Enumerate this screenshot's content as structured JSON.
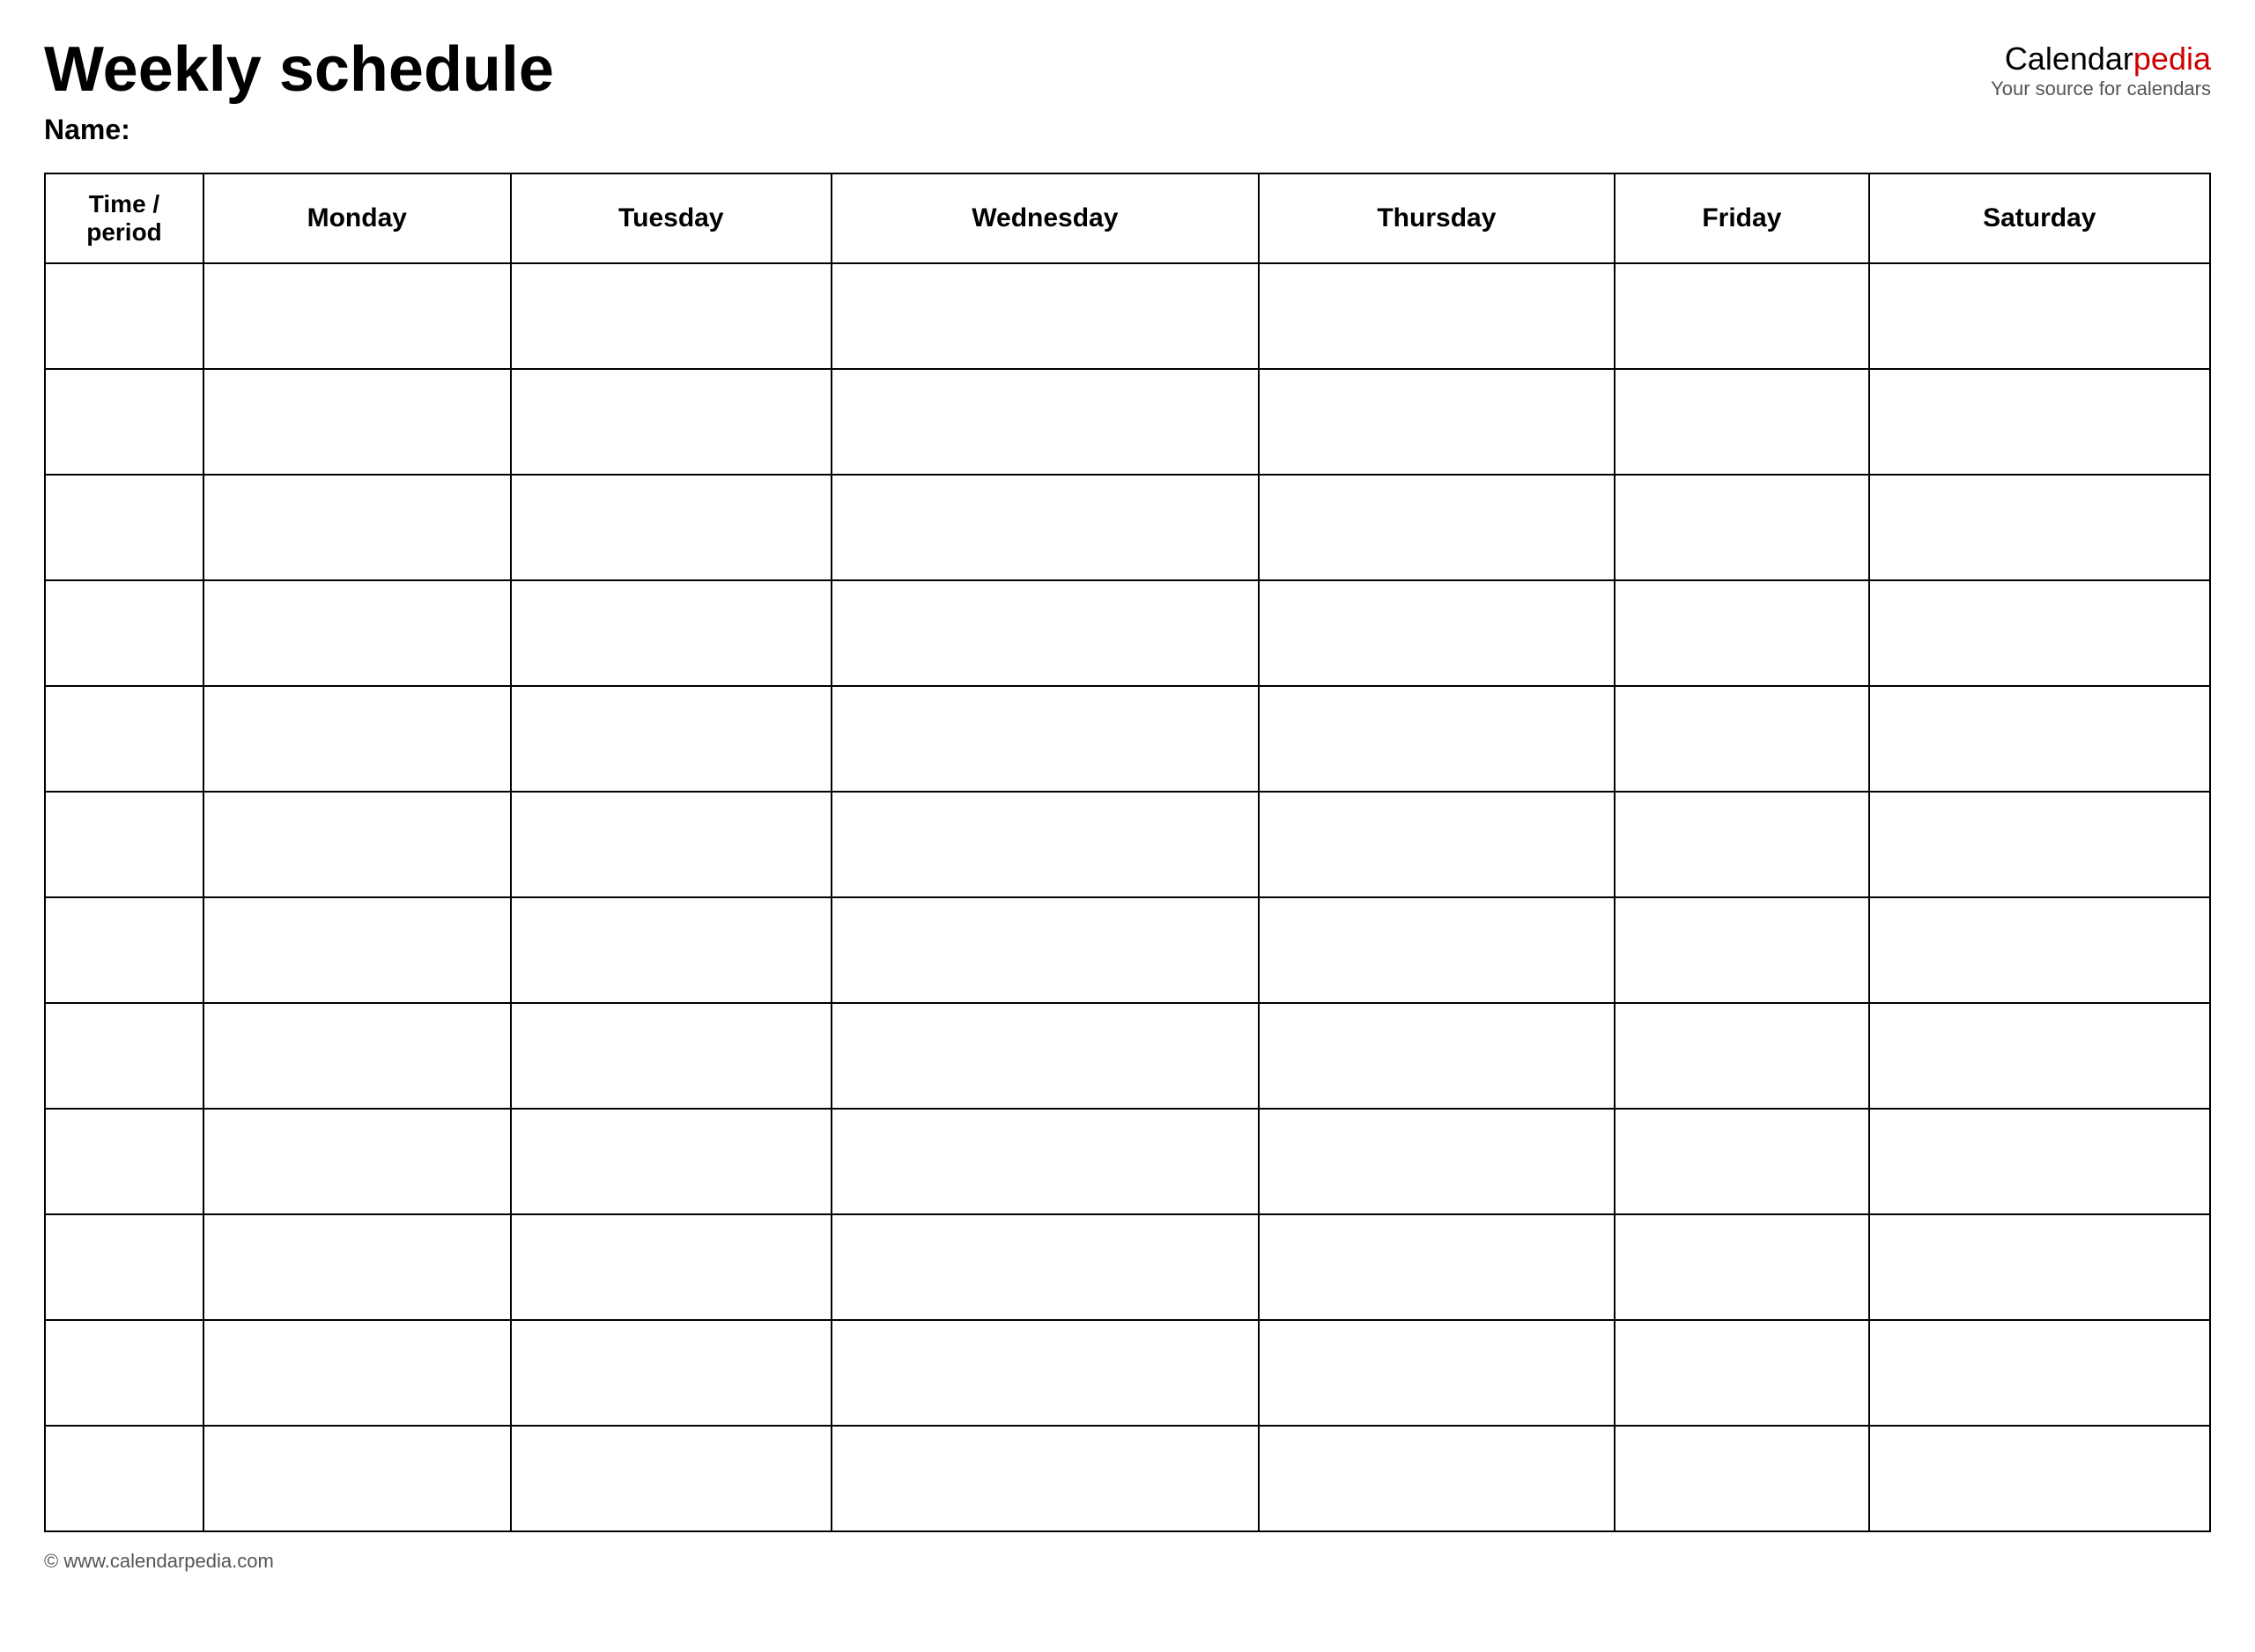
{
  "header": {
    "title": "Weekly schedule",
    "name_label": "Name:",
    "logo_calendar": "Calendar",
    "logo_pedia": "pedia",
    "logo_tagline": "Your source for calendars"
  },
  "table": {
    "columns": [
      {
        "id": "time",
        "label": "Time / period"
      },
      {
        "id": "monday",
        "label": "Monday"
      },
      {
        "id": "tuesday",
        "label": "Tuesday"
      },
      {
        "id": "wednesday",
        "label": "Wednesday"
      },
      {
        "id": "thursday",
        "label": "Thursday"
      },
      {
        "id": "friday",
        "label": "Friday"
      },
      {
        "id": "saturday",
        "label": "Saturday"
      }
    ],
    "row_count": 12
  },
  "footer": {
    "url": "© www.calendarpedia.com"
  }
}
